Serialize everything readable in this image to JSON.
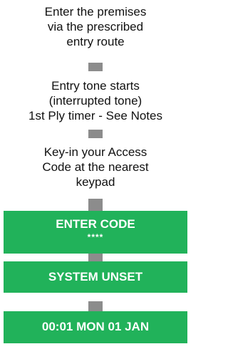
{
  "steps": [
    {
      "lines": [
        "Enter the premises",
        "via the prescribed",
        "entry route"
      ]
    },
    {
      "lines": [
        "Entry tone starts",
        "(interrupted tone)",
        "1st Ply timer - See Notes"
      ]
    },
    {
      "lines": [
        "Key-in your Access",
        "Code at the nearest",
        "keypad"
      ]
    }
  ],
  "displays": [
    {
      "title": "ENTER CODE",
      "subtitle": "****"
    },
    {
      "title": "SYSTEM UNSET"
    },
    {
      "title": "00:01 MON 01 JAN"
    }
  ],
  "colors": {
    "display_bg": "#21b25a",
    "display_text": "#ffffff",
    "connector": "#8c8c8c"
  }
}
